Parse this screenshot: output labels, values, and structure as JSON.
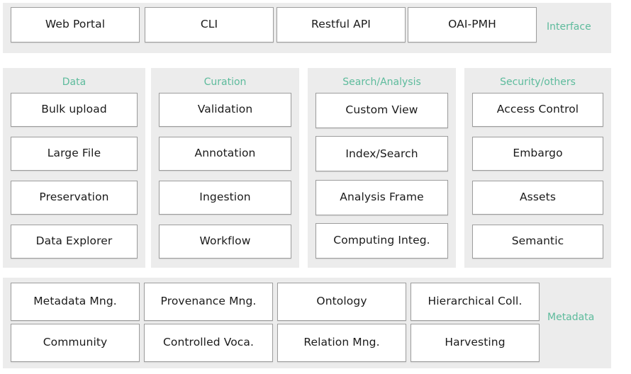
{
  "accent_color": "#5dbb9c",
  "panel_background": "#ececec",
  "box_background": "#ffffff",
  "box_border_color": "#9d9d9d",
  "text_color": "#1a1a1a",
  "interface": {
    "tag": "Interface",
    "items": [
      {
        "label": "Web Portal"
      },
      {
        "label": "CLI"
      },
      {
        "label": "Restful API"
      },
      {
        "label": "OAI-PMH"
      }
    ]
  },
  "columns": [
    {
      "header": "Data",
      "items": [
        {
          "label": "Bulk upload"
        },
        {
          "label": "Large File"
        },
        {
          "label": "Preservation"
        },
        {
          "label": "Data Explorer"
        }
      ]
    },
    {
      "header": "Curation",
      "items": [
        {
          "label": "Validation"
        },
        {
          "label": "Annotation"
        },
        {
          "label": "Ingestion"
        },
        {
          "label": "Workflow"
        }
      ]
    },
    {
      "header": "Search/Analysis",
      "items": [
        {
          "label": "Custom View"
        },
        {
          "label": "Index/Search"
        },
        {
          "label": "Analysis Frame"
        },
        {
          "label": "Computing Integ."
        }
      ]
    },
    {
      "header": "Security/others",
      "items": [
        {
          "label": "Access Control"
        },
        {
          "label": "Embargo"
        },
        {
          "label": "Assets"
        },
        {
          "label": "Semantic"
        }
      ]
    }
  ],
  "metadata": {
    "tag": "Metadata",
    "items": [
      {
        "label": "Metadata Mng."
      },
      {
        "label": "Provenance Mng."
      },
      {
        "label": "Ontology"
      },
      {
        "label": "Hierarchical Coll."
      },
      {
        "label": "Community"
      },
      {
        "label": "Controlled Voca."
      },
      {
        "label": "Relation Mng."
      },
      {
        "label": "Harvesting"
      }
    ]
  }
}
